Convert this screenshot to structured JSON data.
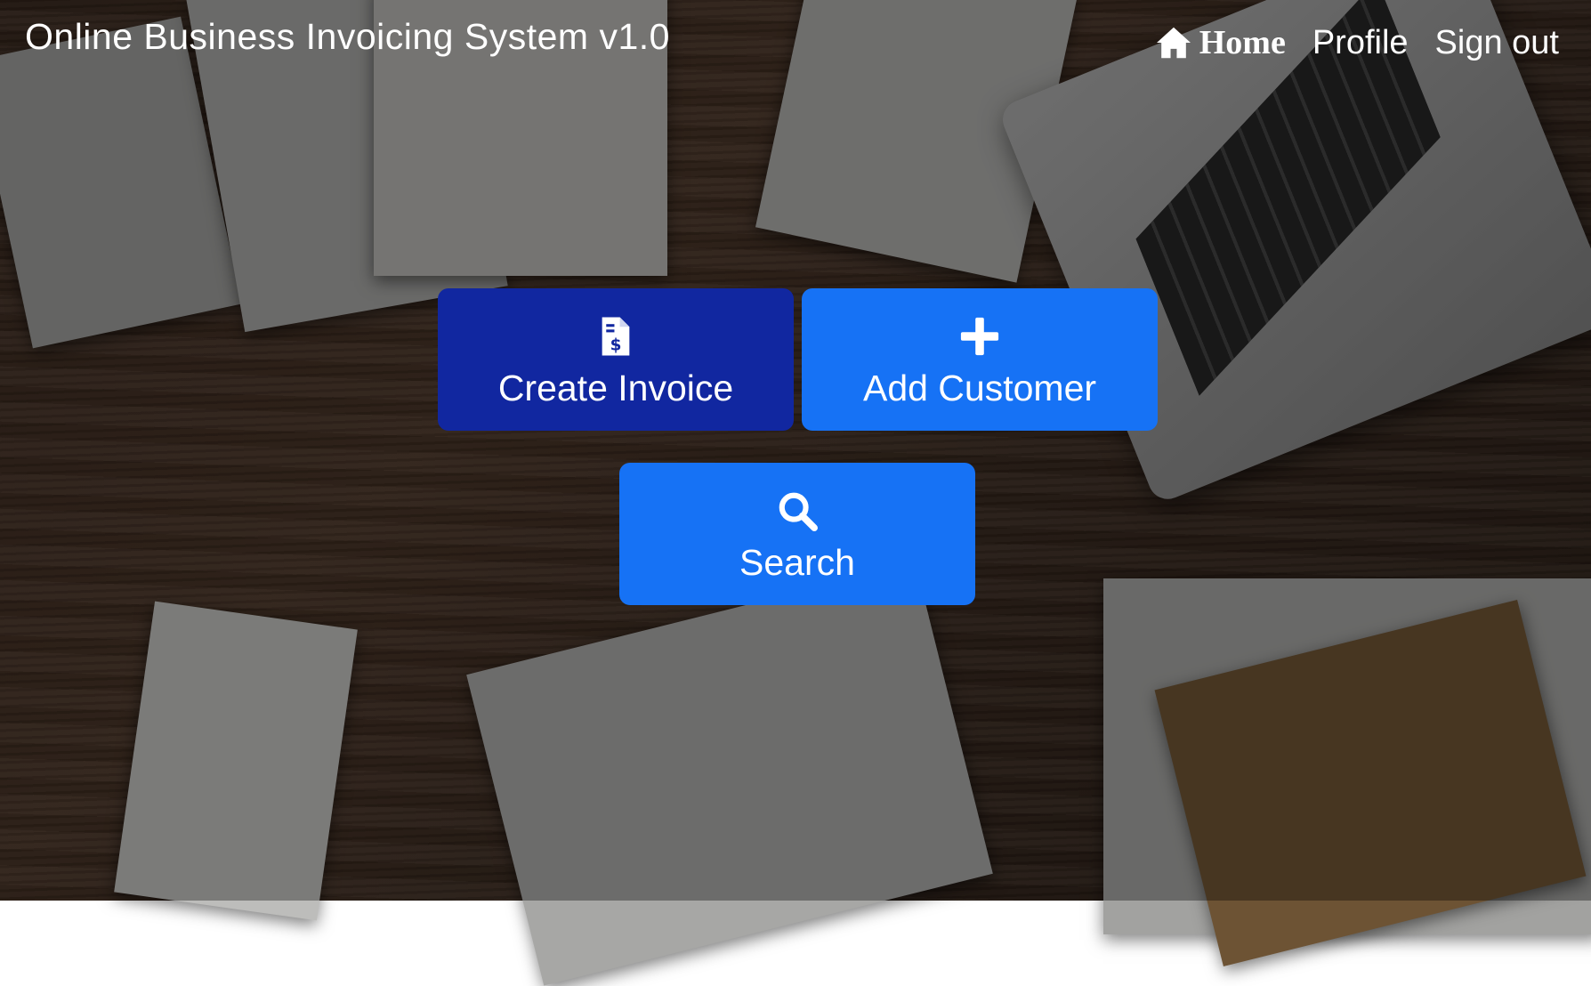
{
  "header": {
    "title": "Online Business Invoicing System v1.0"
  },
  "nav": {
    "items": [
      {
        "label": "Home",
        "icon": "home-icon",
        "active": true
      },
      {
        "label": "Profile",
        "active": false
      },
      {
        "label": "Sign out",
        "active": false
      }
    ]
  },
  "actions": {
    "create_invoice": {
      "label": "Create Invoice",
      "icon": "invoice-dollar-icon"
    },
    "add_customer": {
      "label": "Add Customer",
      "icon": "plus-icon"
    },
    "search": {
      "label": "Search",
      "icon": "search-icon"
    }
  },
  "colors": {
    "primary_dark": "#1127a0",
    "primary": "#1672f5",
    "text": "#ffffff"
  }
}
